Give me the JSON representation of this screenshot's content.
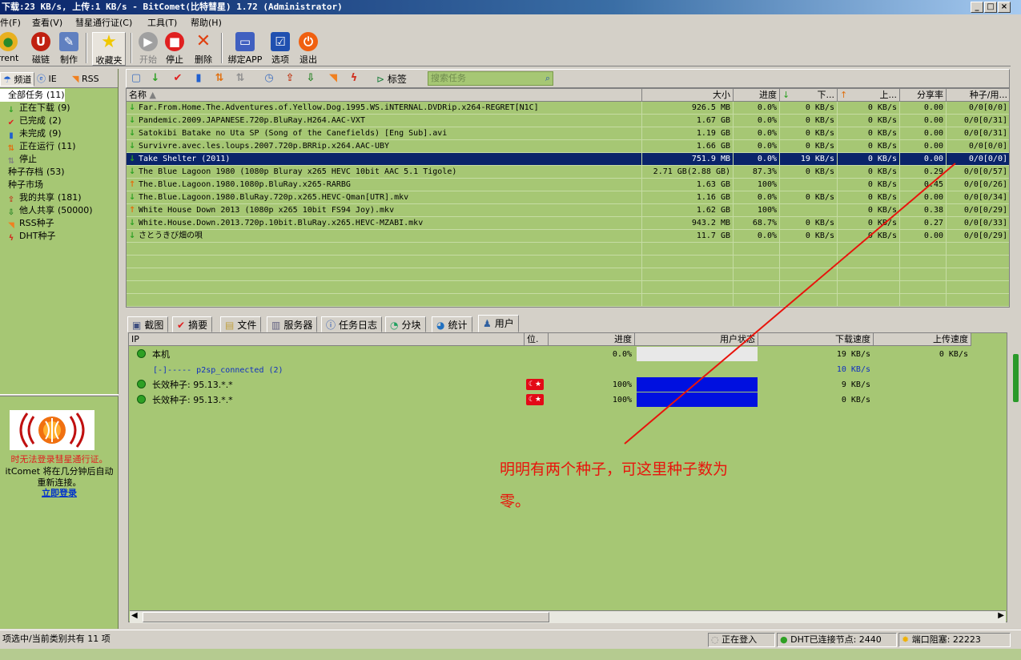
{
  "window": {
    "title": "下载:23 KB/s, 上传:1 KB/s - BitComet(比特彗星) 1.72 (Administrator)",
    "buttons": [
      "_",
      "□",
      "×"
    ]
  },
  "menu": [
    "件(F)",
    "查看(V)",
    "彗星通行证(C)",
    "工具(T)",
    "帮助(H)"
  ],
  "toolbar": [
    {
      "label": "rrent",
      "icon": "torrent-icon",
      "color": "#e8b020",
      "glyph": "●"
    },
    {
      "label": "磁链",
      "icon": "magnet-icon",
      "color": "#c02010",
      "glyph": "U"
    },
    {
      "label": "制作",
      "icon": "make-torrent-icon",
      "color": "#6080c0",
      "glyph": "✎"
    },
    {
      "label": "收藏夹",
      "icon": "favorites-star-icon",
      "color": "#f8d820",
      "glyph": "★"
    },
    {
      "label": "开始",
      "icon": "start-icon",
      "color": "#909090",
      "glyph": "▶"
    },
    {
      "label": "停止",
      "icon": "stop-icon",
      "color": "#e02020",
      "glyph": "■"
    },
    {
      "label": "删除",
      "icon": "delete-x-icon",
      "color": "#e04010",
      "glyph": "✕"
    },
    {
      "label": "绑定APP",
      "icon": "bind-app-icon",
      "color": "#4060c0",
      "glyph": "▭"
    },
    {
      "label": "选项",
      "icon": "options-icon",
      "color": "#2050b0",
      "glyph": "☑"
    },
    {
      "label": "退出",
      "icon": "exit-power-icon",
      "color": "#f06010",
      "glyph": "⏻"
    }
  ],
  "sidebar": {
    "tabs": [
      "频道",
      "IE",
      "RSS"
    ],
    "items": [
      {
        "label": "全部任务",
        "count": "(11)",
        "indent": 0,
        "icon": "all-tasks-icon",
        "glyph": "",
        "color": "#000"
      },
      {
        "label": "正在下载",
        "count": "(9)",
        "indent": 1,
        "icon": "downloading-arrow-icon",
        "glyph": "↓",
        "color": "#2ea024"
      },
      {
        "label": "已完成",
        "count": "(2)",
        "indent": 1,
        "icon": "completed-check-icon",
        "glyph": "✔",
        "color": "#e02020"
      },
      {
        "label": "未完成",
        "count": "(9)",
        "indent": 1,
        "icon": "incomplete-icon",
        "glyph": "▮",
        "color": "#2060d0"
      },
      {
        "label": "正在运行",
        "count": "(11)",
        "indent": 1,
        "icon": "running-icon",
        "glyph": "⇅",
        "color": "#e07010"
      },
      {
        "label": "停止",
        "count": "",
        "indent": 1,
        "icon": "stopped-icon",
        "glyph": "⇅",
        "color": "#808080"
      },
      {
        "label": "种子存档",
        "count": "(53)",
        "indent": 0,
        "icon": "torrent-archive-icon",
        "glyph": "",
        "color": "#000"
      },
      {
        "label": "种子市场",
        "count": "",
        "indent": 0,
        "icon": "torrent-market-icon",
        "glyph": "",
        "color": "#000"
      },
      {
        "label": "我的共享",
        "count": "(181)",
        "indent": 1,
        "icon": "my-share-icon",
        "glyph": "⇪",
        "color": "#c04020"
      },
      {
        "label": "他人共享",
        "count": "(50000)",
        "indent": 1,
        "icon": "others-share-icon",
        "glyph": "⇩",
        "color": "#208020"
      },
      {
        "label": "RSS种子",
        "count": "",
        "indent": 1,
        "icon": "rss-icon",
        "glyph": "◥",
        "color": "#f08020"
      },
      {
        "label": "DHT种子",
        "count": "",
        "indent": 1,
        "icon": "dht-icon",
        "glyph": "ϟ",
        "color": "#d03020"
      }
    ],
    "notice_line1": "时无法登录彗星通行证。",
    "notice_line2": "itComet 将在几分钟后自动",
    "notice_line3": "重新连接。",
    "notice_link": "立即登录"
  },
  "task_toolbar": {
    "tag_label": "标签",
    "search_placeholder": "搜索任务",
    "icons": [
      "new-task-icon",
      "download-icon",
      "check-icon",
      "incomplete-icon",
      "running-icon",
      "stopped-icon",
      "schedule-icon",
      "share-icon",
      "dht-down-icon",
      "rss-icon",
      "lightning-icon",
      "tag-icon"
    ]
  },
  "task_columns": [
    "名称",
    "大小",
    "进度",
    "下...",
    "上...",
    "分享率",
    "种子/用..."
  ],
  "tasks": [
    {
      "name": "Far.From.Home.The.Adventures.of.Yellow.Dog.1995.WS.iNTERNAL.DVDRip.x264-REGRET[N1C]",
      "size": "926.5 MB",
      "progress": "0.0%",
      "down": "0 KB/s",
      "up": "0 KB/s",
      "ratio": "0.00",
      "seeds": "0/0[0/0]",
      "dir": "down",
      "selected": false
    },
    {
      "name": "Pandemic.2009.JAPANESE.720p.BluRay.H264.AAC-VXT",
      "size": "1.67 GB",
      "progress": "0.0%",
      "down": "0 KB/s",
      "up": "0 KB/s",
      "ratio": "0.00",
      "seeds": "0/0[0/31]",
      "dir": "down",
      "selected": false
    },
    {
      "name": "Satokibi Batake no Uta SP (Song of the Canefields) [Eng Sub].avi",
      "size": "1.19 GB",
      "progress": "0.0%",
      "down": "0 KB/s",
      "up": "0 KB/s",
      "ratio": "0.00",
      "seeds": "0/0[0/31]",
      "dir": "down",
      "selected": false
    },
    {
      "name": "Survivre.avec.les.loups.2007.720p.BRRip.x264.AAC-UBY",
      "size": "1.66 GB",
      "progress": "0.0%",
      "down": "0 KB/s",
      "up": "0 KB/s",
      "ratio": "0.00",
      "seeds": "0/0[0/0]",
      "dir": "down",
      "selected": false
    },
    {
      "name": "Take Shelter (2011)",
      "size": "751.9 MB",
      "progress": "0.0%",
      "down": "19 KB/s",
      "up": "0 KB/s",
      "ratio": "0.00",
      "seeds": "0/0[0/0]",
      "dir": "down",
      "selected": true
    },
    {
      "name": "The Blue Lagoon 1980 (1080p Bluray x265 HEVC 10bit AAC 5.1 Tigole)",
      "size": "2.71 GB(2.88 GB)",
      "progress": "87.3%",
      "down": "0 KB/s",
      "up": "0 KB/s",
      "ratio": "0.29",
      "seeds": "0/0[0/57]",
      "dir": "down",
      "selected": false
    },
    {
      "name": "The.Blue.Lagoon.1980.1080p.BluRay.x265-RARBG",
      "size": "1.63 GB",
      "progress": "100%",
      "down": "",
      "up": "0 KB/s",
      "ratio": "0.45",
      "seeds": "0/0[0/26]",
      "dir": "up",
      "selected": false
    },
    {
      "name": "The.Blue.Lagoon.1980.BluRay.720p.x265.HEVC-Qman[UTR].mkv",
      "size": "1.16 GB",
      "progress": "0.0%",
      "down": "0 KB/s",
      "up": "0 KB/s",
      "ratio": "0.00",
      "seeds": "0/0[0/34]",
      "dir": "down",
      "selected": false
    },
    {
      "name": "White House Down 2013 (1080p x265 10bit FS94 Joy).mkv",
      "size": "1.62 GB",
      "progress": "100%",
      "down": "",
      "up": "0 KB/s",
      "ratio": "0.38",
      "seeds": "0/0[0/29]",
      "dir": "up",
      "selected": false
    },
    {
      "name": "White.House.Down.2013.720p.10bit.BluRay.x265.HEVC-MZABI.mkv",
      "size": "943.2 MB",
      "progress": "68.7%",
      "down": "0 KB/s",
      "up": "0 KB/s",
      "ratio": "0.27",
      "seeds": "0/0[0/33]",
      "dir": "down",
      "selected": false
    },
    {
      "name": "さとうきび畑の唄",
      "size": "11.7 GB",
      "progress": "0.0%",
      "down": "0 KB/s",
      "up": "0 KB/s",
      "ratio": "0.00",
      "seeds": "0/0[0/29]",
      "dir": "down",
      "selected": false
    }
  ],
  "bottom_tabs": [
    {
      "label": "截图",
      "icon": "screenshot-icon"
    },
    {
      "label": "摘要",
      "icon": "summary-icon"
    },
    {
      "label": "文件",
      "icon": "files-icon"
    },
    {
      "label": "服务器",
      "icon": "server-icon"
    },
    {
      "label": "任务日志",
      "icon": "info-log-icon"
    },
    {
      "label": "分块",
      "icon": "pieces-icon"
    },
    {
      "label": "统计",
      "icon": "stats-icon"
    },
    {
      "label": "用户",
      "icon": "users-icon"
    }
  ],
  "peer_columns": [
    "IP",
    "位.",
    "进度",
    "用户状态",
    "下载速度",
    "上传速度"
  ],
  "peers": [
    {
      "ip": "本机",
      "flag": false,
      "progress": "0.0%",
      "fill": 0.0,
      "down": "19 KB/s",
      "up": "0 KB/s",
      "dot": true,
      "link": false
    },
    {
      "ip": "[-]----- p2sp_connected (2)",
      "flag": false,
      "progress": "",
      "fill": null,
      "down": "10 KB/s",
      "up": "",
      "dot": false,
      "link": true
    },
    {
      "ip": "长效种子: 95.13.*.*",
      "flag": true,
      "progress": "100%",
      "fill": 1.0,
      "down": "9 KB/s",
      "up": "",
      "dot": true,
      "link": false
    },
    {
      "ip": "长效种子: 95.13.*.*",
      "flag": true,
      "progress": "100%",
      "fill": 1.0,
      "down": "0 KB/s",
      "up": "",
      "dot": true,
      "link": false
    }
  ],
  "annotation": {
    "line1": "明明有两个种子，可这里种子数为",
    "line2": "零。",
    "color": "#e8140c"
  },
  "statusbar": {
    "left": "项选中/当前类别共有 11 项",
    "login": "正在登入",
    "dht": "DHT已连接节点: 2440",
    "port": "端口阻塞: 22223"
  }
}
